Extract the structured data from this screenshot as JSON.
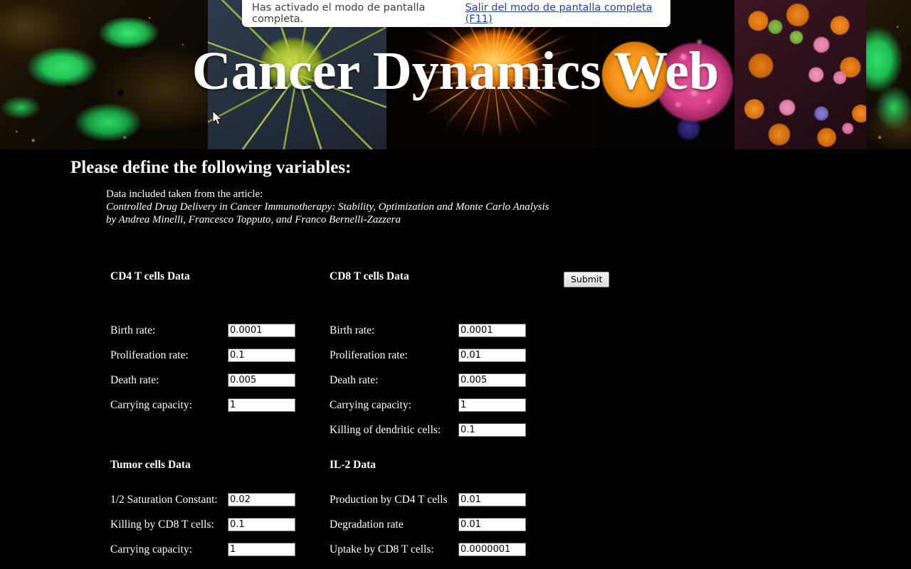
{
  "browser_notice": {
    "message": "Has activado el modo de pantalla completa.",
    "exit_link": "Salir del modo de pantalla completa (F11)"
  },
  "banner": {
    "title": "Cancer Dynamics Web",
    "panels": [
      {
        "name": "green-cancer-cells"
      },
      {
        "name": "yellow-spiky-cell"
      },
      {
        "name": "orange-fiery-cell"
      },
      {
        "name": "orange-magenta-cell"
      },
      {
        "name": "blood-cells-micrograph"
      },
      {
        "name": "green-cancer-cells-repeat"
      }
    ]
  },
  "page": {
    "heading": "Please define the following variables:",
    "citation_intro": "Data included taken from the article:",
    "citation_title": "Controlled Drug Delivery in Cancer Immunotherapy: Stability, Optimization and Monte Carlo Analysis",
    "citation_authors": "by Andrea Minelli, Francesco Topputo, and Franco Bernelli-Zazzera"
  },
  "form": {
    "submit_label": "Submit",
    "sections": {
      "cd4": {
        "title": "CD4 T cells Data",
        "fields": [
          {
            "label": "Birth rate:",
            "value": "0.0001"
          },
          {
            "label": "Proliferation rate:",
            "value": "0.1"
          },
          {
            "label": "Death rate:",
            "value": "0.005"
          },
          {
            "label": "Carrying capacity:",
            "value": "1"
          }
        ]
      },
      "cd8": {
        "title": "CD8 T cells Data",
        "fields": [
          {
            "label": "Birth rate:",
            "value": "0.0001"
          },
          {
            "label": "Proliferation rate:",
            "value": "0.01"
          },
          {
            "label": "Death rate:",
            "value": "0.005"
          },
          {
            "label": "Carrying capacity:",
            "value": "1"
          },
          {
            "label": "Killing of dendritic cells:",
            "value": "0.1"
          }
        ]
      },
      "tumor": {
        "title": "Tumor cells Data",
        "fields": [
          {
            "label": "1/2 Saturation Constant:",
            "value": "0.02"
          },
          {
            "label": "Killing by CD8 T cells:",
            "value": "0.1"
          },
          {
            "label": "Carrying capacity:",
            "value": "1"
          }
        ]
      },
      "il2": {
        "title": "IL-2 Data",
        "fields": [
          {
            "label": "Production by CD4 T cells",
            "value": "0.01"
          },
          {
            "label": "Degradation rate",
            "value": "0.01"
          },
          {
            "label": "Uptake by CD8 T cells:",
            "value": "0.0000001"
          }
        ]
      }
    }
  },
  "colors": {
    "page_background": "#000000",
    "text": "#ffffff",
    "link": "#1b42c8",
    "notice_background": "#ffffff",
    "input_background": "#ffffff"
  }
}
